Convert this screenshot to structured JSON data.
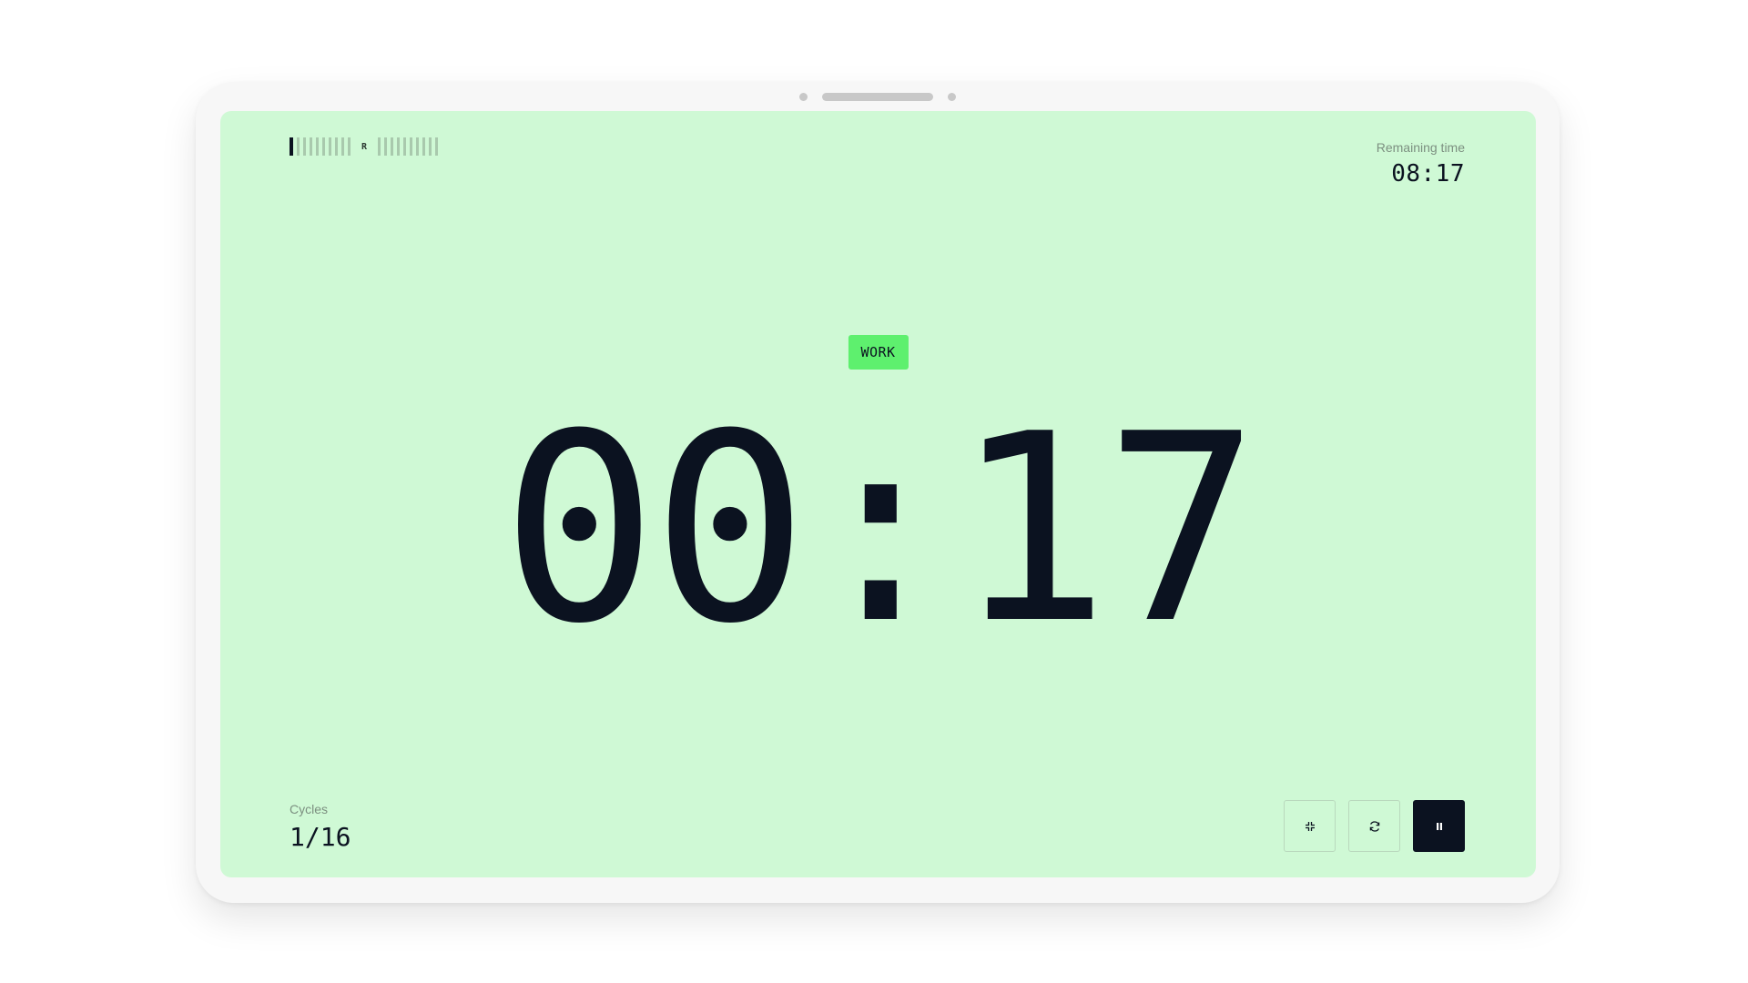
{
  "cycle_strip": {
    "work_ticks_before": 10,
    "rest_marker": "R",
    "work_ticks_after": 10,
    "active_index": 0,
    "active_color": "#0b1220",
    "inactive_color": "#a9c9ad"
  },
  "remaining": {
    "label": "Remaining time",
    "value": "08:17"
  },
  "phase": {
    "label": "WORK",
    "color": "#5ef06e"
  },
  "timer": {
    "value": "00:17"
  },
  "cycles": {
    "label": "Cycles",
    "value": "1/16"
  },
  "controls": {
    "icons": [
      "shrink-icon",
      "restart-icon",
      "pause-icon"
    ]
  },
  "theme": {
    "screen_bg": "#cff9d5",
    "text": "#0b1220"
  }
}
